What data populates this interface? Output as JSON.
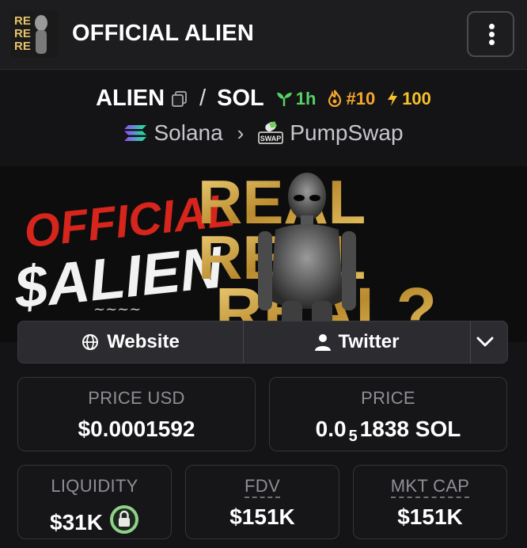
{
  "header": {
    "title": "OFFICIAL ALIEN",
    "avatar_text": "REAL"
  },
  "pair": {
    "base": "ALIEN",
    "separator": "/",
    "quote": "SOL",
    "age": "1h",
    "rank": "#10",
    "boost": "100"
  },
  "chain": {
    "network": "Solana",
    "dex": "PumpSwap",
    "dex_badge": "SWAP"
  },
  "banner": {
    "line1": "OFFICIAL",
    "line2": "$ALIEN",
    "real": [
      "REAL",
      "REAL",
      "REAL?"
    ]
  },
  "links": {
    "website": "Website",
    "twitter": "Twitter"
  },
  "stats": {
    "price_usd_label": "PRICE USD",
    "price_usd_value": "$0.0001592",
    "price_label": "PRICE",
    "price_prefix": "0.0",
    "price_subscript": "5",
    "price_digits": "1838 SOL",
    "liquidity_label": "LIQUIDITY",
    "liquidity_value": "$31K",
    "fdv_label": "FDV",
    "fdv_value": "$151K",
    "mktcap_label": "MKT CAP",
    "mktcap_value": "$151K"
  },
  "colors": {
    "age_green": "#56d364",
    "rank_orange": "#f6a72c",
    "boost_yellow": "#f6c12c",
    "lock_green": "#8fd18a"
  }
}
